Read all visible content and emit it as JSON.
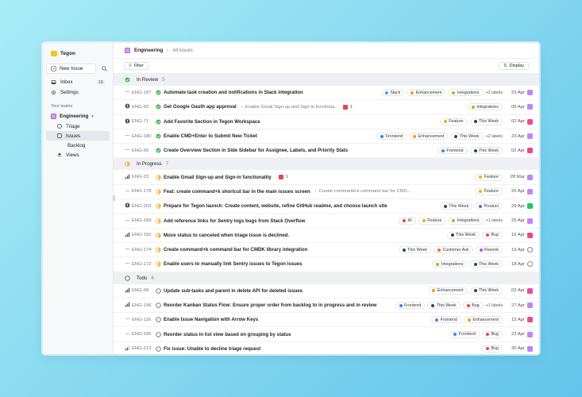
{
  "sidebar": {
    "workspace": "Tegon",
    "new_issue": "New Issue",
    "nav": [
      {
        "label": "Inbox",
        "count": "16",
        "icon": "inbox-icon"
      },
      {
        "label": "Settings",
        "count": "",
        "icon": "gear-icon"
      }
    ],
    "teams_header": "Your teams",
    "team": "Engineering",
    "team_items": [
      {
        "label": "Triage",
        "icon": "triage-icon",
        "active": false
      },
      {
        "label": "Issues",
        "icon": "issues-icon",
        "active": true
      },
      {
        "label": "Backlog",
        "icon": "",
        "active": false
      },
      {
        "label": "Views",
        "icon": "views-icon",
        "active": false
      }
    ]
  },
  "header": {
    "team": "Engineering",
    "page": "All issues"
  },
  "toolbar": {
    "filter": "Filter",
    "display": "Display"
  },
  "colors": {
    "in_review": "#3fb950",
    "in_progress": "#f5a623",
    "todo": "#555555",
    "urgent": "#e5484d"
  },
  "groups": [
    {
      "name": "In Review",
      "count": "5",
      "status": "in_review",
      "issues": [
        {
          "id": "ENG-187",
          "priority": "none",
          "title": "Automate task creation and notifications in Slack integration",
          "sub": "",
          "badge": "",
          "labels": [
            {
              "t": "Slack",
              "c": "#4a9eff"
            },
            {
              "t": "Enhancement",
              "c": "#f59e0b"
            },
            {
              "t": "Integrations",
              "c": "#84cc16"
            }
          ],
          "more": "+2 labels",
          "date": "23 Apr",
          "av": "#c084fc"
        },
        {
          "id": "ENG-92",
          "priority": "urgent",
          "title": "Get Google Oauth app approval",
          "sub": "Enable Gmail Sign-up and Sign-in functiona...",
          "badge": "1",
          "labels": [
            {
              "t": "Integrations",
              "c": "#84cc16"
            }
          ],
          "more": "",
          "date": "09 Apr",
          "av": "#c084fc"
        },
        {
          "id": "ENG-71",
          "priority": "urgent",
          "title": "Add Favorite Section in Tegon Workspace",
          "sub": "",
          "badge": "",
          "labels": [
            {
              "t": "Feature",
              "c": "#eab308"
            },
            {
              "t": "This Week",
              "c": "#374151"
            }
          ],
          "more": "",
          "date": "02 Apr",
          "av": "#ec4899"
        },
        {
          "id": "ENG-180",
          "priority": "none",
          "title": "Enable CMD+Enter to Submit New Ticket",
          "sub": "",
          "badge": "",
          "labels": [
            {
              "t": "Frontend",
              "c": "#3b82f6"
            },
            {
              "t": "Enhancement",
              "c": "#f59e0b"
            },
            {
              "t": "This Week",
              "c": "#374151"
            }
          ],
          "more": "+2 labels",
          "date": "23 Apr",
          "av": "#c084fc"
        },
        {
          "id": "ENG-65",
          "priority": "none",
          "title": "Create Overview Section in Side Sidebar for Assignee, Labels, and Priority Stats",
          "sub": "",
          "badge": "",
          "labels": [
            {
              "t": "Frontend",
              "c": "#3b82f6"
            },
            {
              "t": "This Week",
              "c": "#374151"
            }
          ],
          "more": "",
          "date": "02 Apr",
          "av": "#ec4899"
        }
      ]
    },
    {
      "name": "In Progress",
      "count": "7",
      "status": "in_progress",
      "issues": [
        {
          "id": "ENG-23",
          "priority": "high",
          "title": "Enable Gmail Sign-up and Sign-in functionality",
          "sub": "",
          "badge": "1",
          "labels": [
            {
              "t": "Feature",
              "c": "#eab308"
            }
          ],
          "more": "",
          "date": "28 Mar",
          "av": "#c084fc"
        },
        {
          "id": "ENG-178",
          "priority": "none",
          "title": "Feat: create command+k shortcut bar in the main issues screen",
          "sub": "Create command+k command bar for CMD...",
          "badge": "",
          "labels": [
            {
              "t": "Feature",
              "c": "#eab308"
            }
          ],
          "more": "",
          "date": "20 Apr",
          "av": "#c084fc"
        },
        {
          "id": "ENG-203",
          "priority": "urgent",
          "title": "Prepare for Tegon launch: Create content, website, refine GitHub readme, and choose launch site",
          "sub": "",
          "badge": "",
          "labels": [
            {
              "t": "This Week",
              "c": "#374151"
            },
            {
              "t": "Product",
              "c": "#6b7280"
            }
          ],
          "more": "",
          "date": "29 Apr",
          "av": "#22c55e"
        },
        {
          "id": "ENG-189",
          "priority": "none",
          "title": "Add reference links for Sentry logs bugs from Stack Overflow",
          "sub": "",
          "badge": "",
          "labels": [
            {
              "t": "AI",
              "c": "#ef4444"
            },
            {
              "t": "Feature",
              "c": "#eab308"
            },
            {
              "t": "Integrations",
              "c": "#84cc16"
            }
          ],
          "more": "+1 labels",
          "date": "25 Apr",
          "av": "#c084fc"
        },
        {
          "id": "ENG-150",
          "priority": "high",
          "title": "Move status to canceled when triage issue is declined.",
          "sub": "",
          "badge": "",
          "labels": [
            {
              "t": "This Week",
              "c": "#374151"
            },
            {
              "t": "Bug",
              "c": "#ef4444"
            }
          ],
          "more": "",
          "date": "16 Apr",
          "av": "#ec4899"
        },
        {
          "id": "ENG-174",
          "priority": "none",
          "title": "Create command+k command bar for CMDK library integration",
          "sub": "",
          "badge": "",
          "labels": [
            {
              "t": "This Week",
              "c": "#374151"
            },
            {
              "t": "Customer Ask",
              "c": "#f97316"
            },
            {
              "t": "Rework",
              "c": "#a855f7"
            }
          ],
          "more": "",
          "date": "19 Apr",
          "av": "#ffffff"
        },
        {
          "id": "ENG-172",
          "priority": "none",
          "title": "Enable users to manually link Sentry issues to Tegon issues",
          "sub": "",
          "badge": "",
          "labels": [
            {
              "t": "Integrations",
              "c": "#84cc16"
            },
            {
              "t": "This Week",
              "c": "#374151"
            }
          ],
          "more": "",
          "date": "18 Apr",
          "av": "#ffffff"
        }
      ]
    },
    {
      "name": "Todo",
      "count": "6",
      "status": "todo",
      "issues": [
        {
          "id": "ENG-68",
          "priority": "high",
          "title": "Update sub-tasks and parent in delete API for deleted issues",
          "sub": "",
          "badge": "",
          "labels": [
            {
              "t": "Enhancement",
              "c": "#f59e0b"
            },
            {
              "t": "This Week",
              "c": "#374151"
            }
          ],
          "more": "",
          "date": "02 Apr",
          "av": "#ec4899"
        },
        {
          "id": "ENG-196",
          "priority": "high",
          "title": "Reorder Kanban Status Flow: Ensure proper order from backlog to in progress and in review",
          "sub": "",
          "badge": "",
          "labels": [
            {
              "t": "Frontend",
              "c": "#3b82f6"
            },
            {
              "t": "This Week",
              "c": "#374151"
            },
            {
              "t": "Bug",
              "c": "#ef4444"
            }
          ],
          "more": "+1 labels",
          "date": "27 Apr",
          "av": "#c084fc"
        },
        {
          "id": "ENG-116",
          "priority": "none",
          "title": "Enable Issue Navigation with Arrow Keys",
          "sub": "",
          "badge": "",
          "labels": [
            {
              "t": "Frontend",
              "c": "#3b82f6"
            },
            {
              "t": "Enhancement",
              "c": "#f59e0b"
            }
          ],
          "more": "",
          "date": "15 Apr",
          "av": "#ec4899"
        },
        {
          "id": "ENG-185",
          "priority": "none",
          "title": "Reorder status in list view based on grouping by status",
          "sub": "",
          "badge": "",
          "labels": [
            {
              "t": "Frontend",
              "c": "#3b82f6"
            },
            {
              "t": "Bug",
              "c": "#ef4444"
            }
          ],
          "more": "",
          "date": "23 Apr",
          "av": "#c084fc"
        },
        {
          "id": "ENG-213",
          "priority": "medium",
          "title": "Fix issue: Unable to decline triage request",
          "sub": "",
          "badge": "",
          "labels": [
            {
              "t": "Bug",
              "c": "#ef4444"
            }
          ],
          "more": "",
          "date": "30 Apr",
          "av": "#c084fc"
        }
      ]
    }
  ]
}
